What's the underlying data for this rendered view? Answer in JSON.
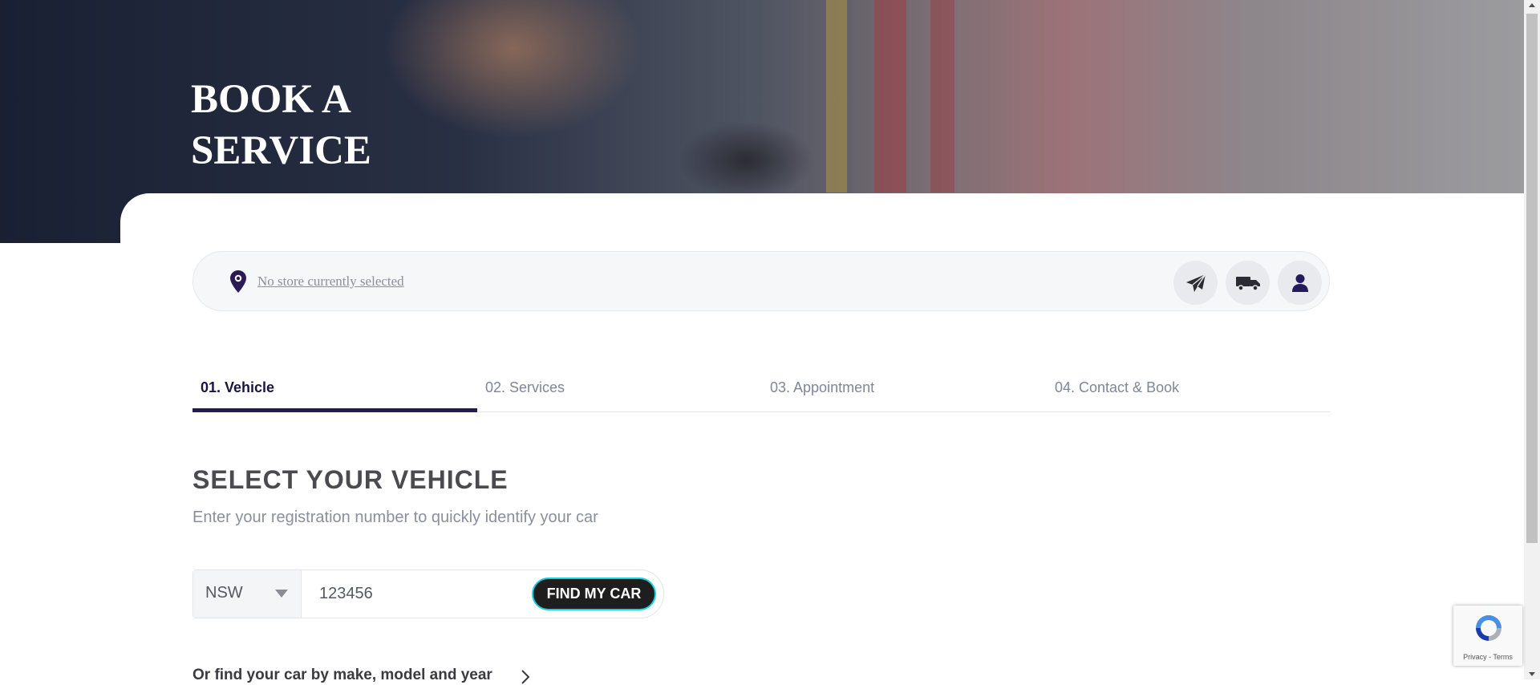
{
  "hero": {
    "title_line1": "BOOK A",
    "title_line2": "SERVICE"
  },
  "store_bar": {
    "store_text": "No store currently selected",
    "location_icon": "map-pin-icon",
    "buttons": [
      "paper-plane-icon",
      "truck-icon",
      "user-icon"
    ]
  },
  "tabs": [
    {
      "label": "01. Vehicle",
      "active": true
    },
    {
      "label": "02. Services",
      "active": false
    },
    {
      "label": "03. Appointment",
      "active": false
    },
    {
      "label": "04. Contact & Book",
      "active": false
    }
  ],
  "vehicle": {
    "heading": "SELECT YOUR VEHICLE",
    "subheading": "Enter your registration number to quickly identify your car",
    "state": "NSW",
    "rego_value": "123456",
    "find_button": "FIND MY CAR",
    "make_model_link": "Or find your car by make, model and year"
  },
  "recaptcha": {
    "links": "Privacy - Terms"
  },
  "colors": {
    "brand_dark": "#241a5c",
    "button_bg": "#1e1e1e",
    "button_outline": "#17d2e0"
  }
}
